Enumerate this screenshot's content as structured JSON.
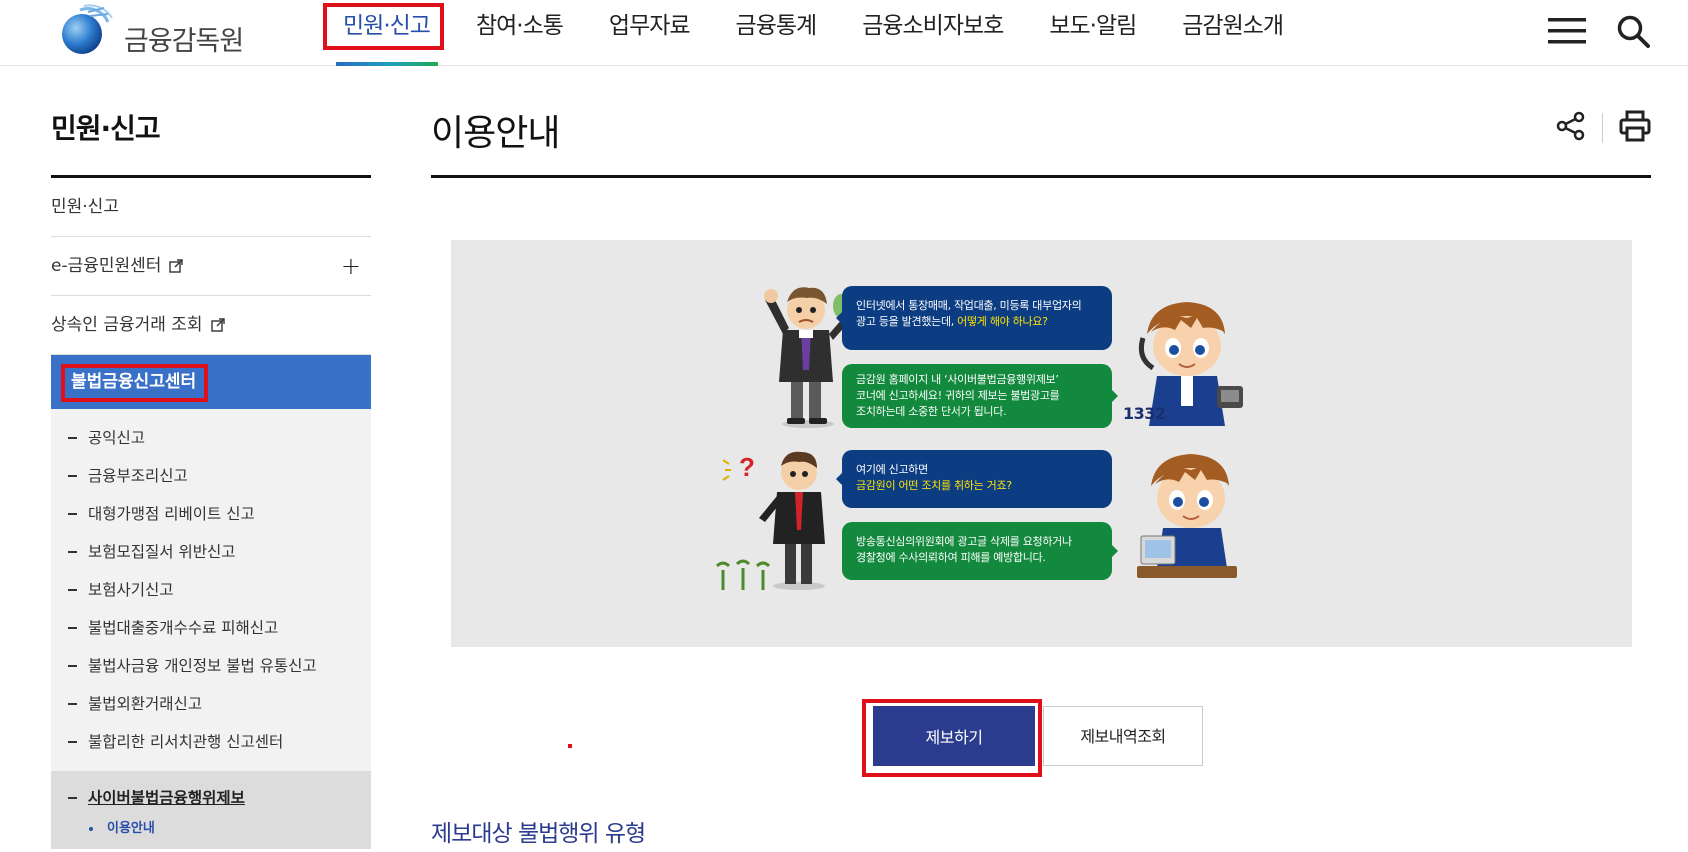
{
  "logo": {
    "text": "금융감독원",
    "icon": "fss-globe-logo-icon"
  },
  "gnb": {
    "items": [
      {
        "label": "민원·신고",
        "active": true
      },
      {
        "label": "참여·소통"
      },
      {
        "label": "업무자료"
      },
      {
        "label": "금융통계"
      },
      {
        "label": "금융소비자보호"
      },
      {
        "label": "보도·알림"
      },
      {
        "label": "금감원소개"
      }
    ],
    "menu_icon": "hamburger-menu-icon",
    "search_icon": "search-icon"
  },
  "lnb": {
    "title": "민원·신고",
    "depth1": [
      {
        "label": "민원·신고"
      },
      {
        "label": "e-금융민원센터",
        "external": true,
        "expandable": true
      },
      {
        "label": "상속인 금융거래 조회",
        "external": true
      }
    ],
    "active_section": "불법금융신고센터",
    "sub_items": [
      {
        "label": "공익신고"
      },
      {
        "label": "금융부조리신고"
      },
      {
        "label": "대형가맹점 리베이트 신고"
      },
      {
        "label": "보험모집질서 위반신고"
      },
      {
        "label": "보험사기신고"
      },
      {
        "label": "불법대출중개수수료 피해신고"
      },
      {
        "label": "불법사금융 개인정보 불법 유통신고"
      },
      {
        "label": "불법외환거래신고"
      },
      {
        "label": "불합리한 리서치관행 신고센터"
      }
    ],
    "current_sub": "사이버불법금융행위제보",
    "current_leaf": "이용안내",
    "plus_symbol": "+"
  },
  "page": {
    "title": "이용안내",
    "share_icon": "share-icon",
    "print_icon": "print-icon"
  },
  "illustration": {
    "bubble1_a": "인터넷에서 통장매매, 작업대출, 미등록 대부업자의",
    "bubble1_b": "광고 등을 발견했는데, ",
    "bubble1_hl": "어떻게 해야 하나요?",
    "bubble2_a": "금감원 홈페이지 내 ‘사이버불법금융행위제보’",
    "bubble2_b": "코너에 신고하세요! 귀하의 제보는 불법광고를",
    "bubble2_c": "조치하는데 소중한 단서가 됩니다.",
    "bubble3_a": "여기에 신고하면",
    "bubble3_hl": "금감원이 어떤 조치를 취하는 거죠?",
    "bubble4_a": "방송통신심의위원회에 광고글 삭제를 요청하거나",
    "bubble4_b": "경찰청에 수사의뢰하여 피해를 예방합니다.",
    "phone_number": "1332"
  },
  "buttons": {
    "report": "제보하기",
    "history": "제보내역조회"
  },
  "section": {
    "title": "제보대상 불법행위 유형"
  },
  "colors": {
    "accent_blue": "#2b3c8e",
    "lnb_active": "#3a71c8",
    "highlight_red": "#e0101a"
  }
}
